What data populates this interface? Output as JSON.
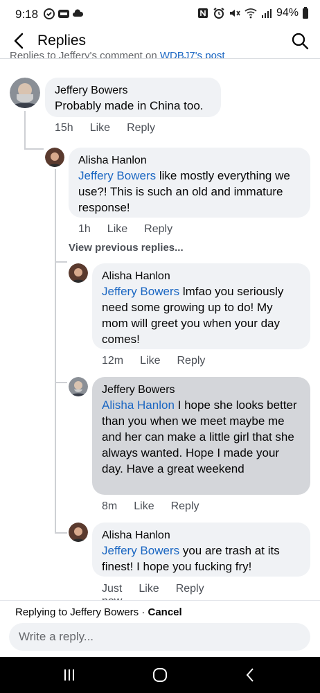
{
  "status": {
    "time": "9:18",
    "battery": "94%",
    "left_icons": [
      "sync-icon",
      "ring-icon",
      "cloud-icon"
    ],
    "right_icons": [
      "nfc-icon",
      "alarm-icon",
      "mute-icon",
      "wifi-icon",
      "signal-icon",
      "battery-icon"
    ]
  },
  "header": {
    "title": "Replies",
    "context_prefix": "Replies to Jeffery's comment on ",
    "context_link": "WDBJ7's post"
  },
  "comments": [
    {
      "author": "Jeffery Bowers",
      "mention": "",
      "text": "Probably made in China too.",
      "time": "15h",
      "like": "Like",
      "reply": "Reply"
    },
    {
      "author": "Alisha Hanlon",
      "mention": "Jeffery Bowers",
      "text": " like mostly everything we use?! This is such an old and immature response!",
      "time": "1h",
      "like": "Like",
      "reply": "Reply"
    },
    {
      "author": "Alisha Hanlon",
      "mention": "Jeffery Bowers",
      "text": " lmfao you seriously need some growing up to do! My mom will greet you when your day comes!",
      "time": "12m",
      "like": "Like",
      "reply": "Reply"
    },
    {
      "author": "Jeffery Bowers",
      "mention": "Alisha Hanlon",
      "text": " I hope she looks better than you when we meet maybe me and her can make a little girl that she always wanted.  Hope I made your day. Have a great weekend",
      "time": "8m",
      "like": "Like",
      "reply": "Reply"
    },
    {
      "author": "Alisha Hanlon",
      "mention": "Jeffery Bowers",
      "text": " you are trash at its finest! I hope you fucking fry!",
      "time": "Just now",
      "like": "Like",
      "reply": "Reply"
    }
  ],
  "view_previous": "View previous replies...",
  "reply_bar": {
    "replying_label": "Replying to ",
    "replying_name": "Jeffery Bowers",
    "separator": " · ",
    "cancel": "Cancel",
    "placeholder": "Write a reply..."
  },
  "colors": {
    "link": "#1a66c2",
    "bubble": "#f0f2f5",
    "bubble_highlight": "#d4d6da"
  }
}
